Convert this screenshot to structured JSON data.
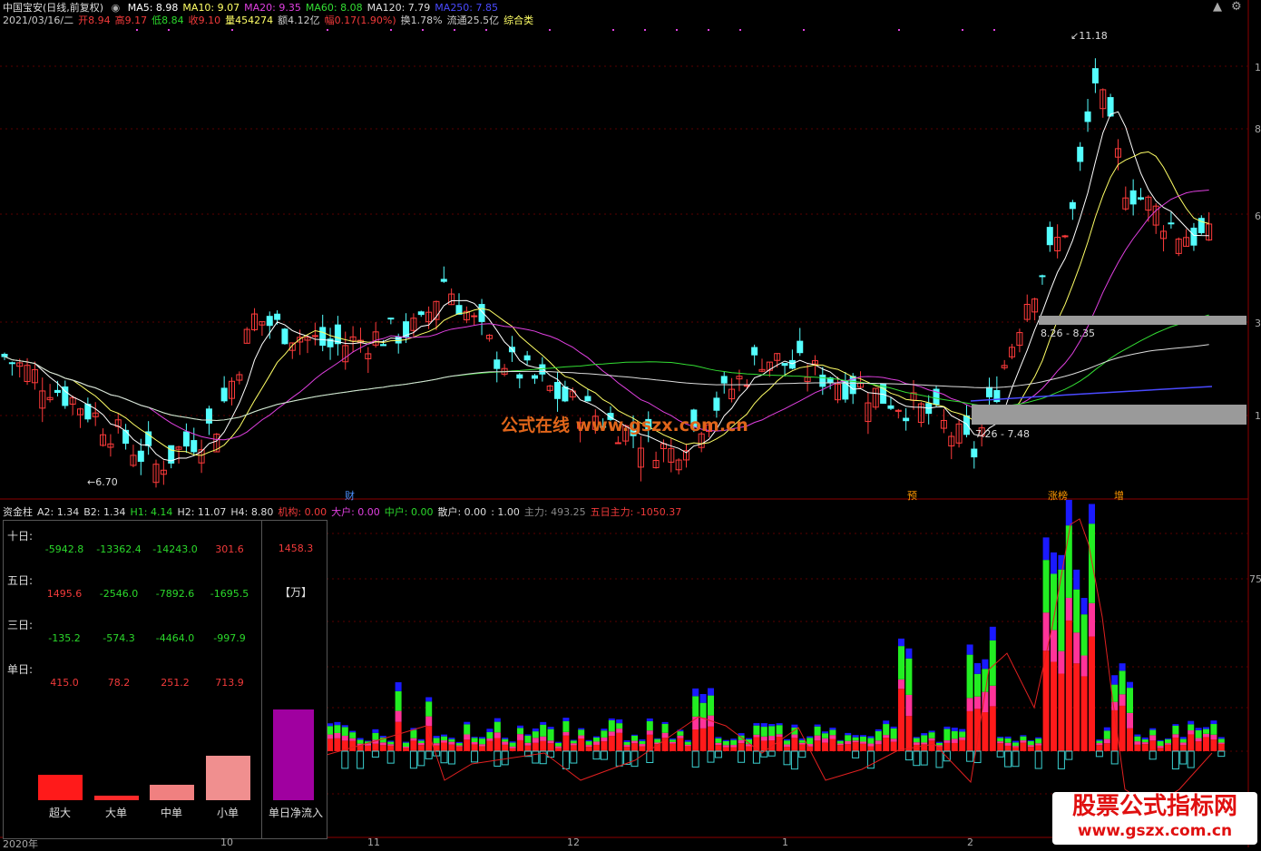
{
  "header": {
    "title": "中国宝安(日线,前复权)",
    "ma": [
      {
        "label": "MA5: 8.98",
        "color": "#ffffff"
      },
      {
        "label": "MA10: 9.07",
        "color": "#ffff66"
      },
      {
        "label": "MA20: 9.35",
        "color": "#e040e0"
      },
      {
        "label": "MA60: 8.08",
        "color": "#33dd33"
      },
      {
        "label": "MA120: 7.79",
        "color": "#dddddd"
      },
      {
        "label": "MA250: 7.85",
        "color": "#4a4aff"
      }
    ],
    "info_line": [
      {
        "text": "2021/03/16/二",
        "color": "#cccccc"
      },
      {
        "text": "开8.94",
        "color": "#f23a3a"
      },
      {
        "text": "高9.17",
        "color": "#f23a3a"
      },
      {
        "text": "低8.84",
        "color": "#2bd92b"
      },
      {
        "text": "收9.10",
        "color": "#f23a3a"
      },
      {
        "text": "量454274",
        "color": "#ffff66"
      },
      {
        "text": "额4.12亿",
        "color": "#cccccc"
      },
      {
        "text": "幅0.17(1.90%)",
        "color": "#f23a3a"
      },
      {
        "text": "换1.78%",
        "color": "#cccccc"
      },
      {
        "text": "流通25.5亿",
        "color": "#cccccc"
      },
      {
        "text": "综合类",
        "color": "#ffff66"
      }
    ]
  },
  "price_labels": {
    "high": "11.18",
    "low": "6.70",
    "zone_upper": "8.26 - 8.35",
    "zone_lower": "7.26 - 7.48"
  },
  "event_tags": [
    {
      "text": "财",
      "color": "#4a90ff"
    },
    {
      "text": "预",
      "color": "#ff9900"
    },
    {
      "text": "涨榜",
      "color": "#ff9900"
    },
    {
      "text": "增",
      "color": "#ff9900"
    }
  ],
  "right_axis": {
    "labels": [
      "1",
      "8",
      "6",
      "3",
      "1"
    ],
    "lower_label": "75"
  },
  "watermark": "公式在线 www.gszx.com.cn",
  "indicator_header": [
    {
      "text": "资金柱",
      "color": "#dddddd"
    },
    {
      "text": "A2: 1.34",
      "color": "#dddddd"
    },
    {
      "text": "B2: 1.34",
      "color": "#dddddd"
    },
    {
      "text": "H1: 4.14",
      "color": "#2bd92b"
    },
    {
      "text": "H2: 11.07",
      "color": "#dddddd"
    },
    {
      "text": "H4: 8.80",
      "color": "#dddddd"
    },
    {
      "text": "机构: 0.00",
      "color": "#f23a3a"
    },
    {
      "text": "大户: 0.00",
      "color": "#e040e0"
    },
    {
      "text": "中户: 0.00",
      "color": "#2bd92b"
    },
    {
      "text": "散户: 0.00",
      "color": "#dddddd"
    },
    {
      "text": ": 1.00",
      "color": "#dddddd"
    },
    {
      "text": "主力: 493.25",
      "color": "#888888"
    },
    {
      "text": "五日主力: -1050.37",
      "color": "#f23a3a"
    }
  ],
  "panel": {
    "rows": [
      {
        "label": "十日:",
        "values": [
          {
            "v": "-5942.8",
            "sign": "neg"
          },
          {
            "v": "-13362.4",
            "sign": "neg"
          },
          {
            "v": "-14243.0",
            "sign": "neg"
          },
          {
            "v": "301.6",
            "sign": "pos"
          }
        ]
      },
      {
        "label": "五日:",
        "values": [
          {
            "v": "1495.6",
            "sign": "pos"
          },
          {
            "v": "-2546.0",
            "sign": "neg"
          },
          {
            "v": "-7892.6",
            "sign": "neg"
          },
          {
            "v": "-1695.5",
            "sign": "neg"
          }
        ]
      },
      {
        "label": "三日:",
        "values": [
          {
            "v": "-135.2",
            "sign": "neg"
          },
          {
            "v": "-574.3",
            "sign": "neg"
          },
          {
            "v": "-4464.0",
            "sign": "neg"
          },
          {
            "v": "-997.9",
            "sign": "neg"
          }
        ]
      },
      {
        "label": "单日:",
        "values": [
          {
            "v": "415.0",
            "sign": "pos"
          },
          {
            "v": "78.2",
            "sign": "pos"
          },
          {
            "v": "251.2",
            "sign": "pos"
          },
          {
            "v": "713.9",
            "sign": "pos"
          }
        ]
      }
    ],
    "net_value": "1458.3",
    "unit": "【万】",
    "bars": [
      {
        "label": "超大",
        "value": 415.0,
        "color": "#ff1a1a"
      },
      {
        "label": "大单",
        "value": 78.2,
        "color": "#ff2a2a"
      },
      {
        "label": "中单",
        "value": 251.2,
        "color": "#f08080"
      },
      {
        "label": "小单",
        "value": 713.9,
        "color": "#f08f8f"
      }
    ],
    "net_bar": {
      "label": "单日净流入",
      "value": 1458.3,
      "color": "#a000a0"
    }
  },
  "x_axis": [
    "2020年",
    "10",
    "11",
    "12",
    "1",
    "2"
  ],
  "logo": {
    "line1": "股票公式指标网",
    "line2": "www.gszx.com.cn"
  }
}
